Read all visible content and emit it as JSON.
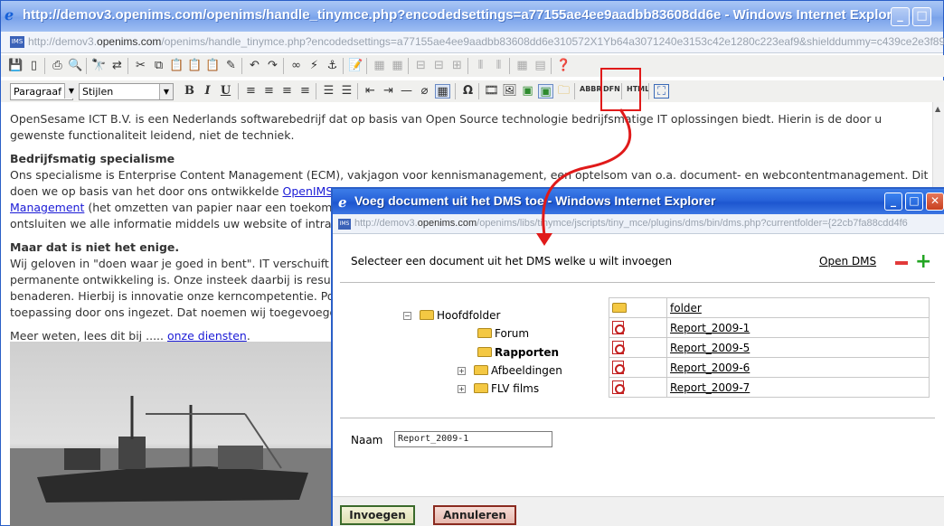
{
  "browser": {
    "title": "http://demov3.openims.com/openims/handle_tinymce.php?encodedsettings=a77155ae4ee9aadbb83608dd6e - Windows Internet Explorer",
    "url_prefix": "http://demov3.",
    "url_domain": "openims.com",
    "url_rest": "/openims/handle_tinymce.php?encodedsettings=a77155ae4ee9aadbb83608dd6e310572X1Yb64a3071240e3153c42e1280c223eaf9&shielddummy=c439ce2e3f89cf76379",
    "favicon": "IMS"
  },
  "editor": {
    "format_select": "Paragraaf",
    "style_select": "Stijlen",
    "abbr": "ABBR",
    "dfn": "DFN",
    "html": "HTML"
  },
  "content": {
    "p1_line1": "OpenSesame ICT B.V. is een Nederlands softwarebedrijf dat op basis van Open Source technologie bedrijfsmatige IT oplossingen biedt. Hierin is de door u",
    "p1_line2": "gewenste functionaliteit leidend, niet de techniek.",
    "h1": "Bedrijfsmatig specialisme",
    "p2_line1": "Ons specialisme is Enterprise Content Management (ECM), vakjagon voor kennismanagement, een optelsom van o.a. document- en webcontentmanagement.  Dit",
    "p2_line2_pre": "doen we op basis van het door ons ontwikkelde ",
    "p2_link1": "OpenIMS",
    "p2_link2": "Management",
    "p2_line3_post": " (het omzetten van papier naar een toekoms",
    "p2_line4": "ontsluiten we alle informatie middels uw website of intra/",
    "h2": "Maar dat is niet het enige.",
    "p3_line1": "Wij geloven in \"doen waar je goed in bent\". IT verschuift",
    "p3_line2": "permanente ontwikkeling is. Onze insteek daarbij is resul",
    "p3_line3": "benaderen. Hierbij is innovatie onze kerncompetentie. Po",
    "p3_line4": "toepassing door ons ingezet. Dat noemen wij toegevoegd",
    "p4_pre": "Meer weten, lees dit bij ..... ",
    "p4_link": "onze diensten",
    "p4_post": "."
  },
  "popup": {
    "title": "Voeg document uit het DMS toe - Windows Internet Explorer",
    "url_prefix": "http://demov3.",
    "url_domain": "openims.com",
    "url_rest": "/openims/libs/tinymce/jscripts/tiny_mce/plugins/dms/bin/dms.php?currentfolder={22cb7fa88cdd4f6",
    "favicon": "IMS",
    "instruction": "Selecteer een document uit het DMS welke u wilt invoegen",
    "open_dms": "Open DMS",
    "tree": {
      "root": "Hoofdfolder",
      "children": [
        "Forum",
        "Rapporten",
        "Afbeeldingen",
        "FLV films"
      ]
    },
    "files": [
      "folder",
      "Report_2009-1",
      "Report_2009-5",
      "Report_2009-6",
      "Report_2009-7"
    ],
    "name_label": "Naam",
    "name_value": "Report_2009-1",
    "insert_label": "Invoegen",
    "cancel_label": "Annuleren"
  }
}
